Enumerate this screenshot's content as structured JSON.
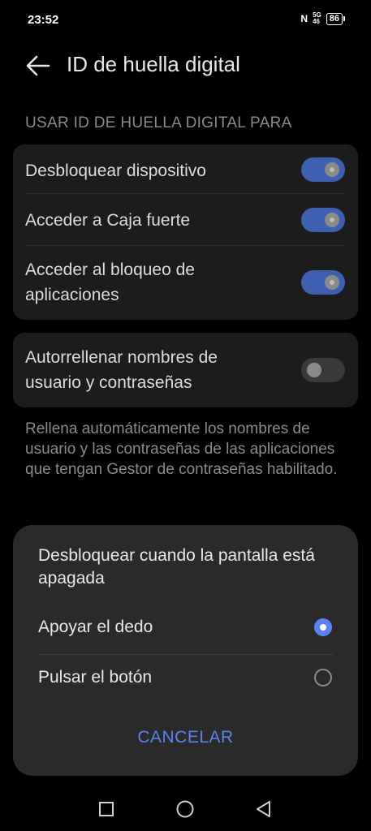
{
  "status_bar": {
    "time": "23:52",
    "nfc": "N",
    "signal_top": "5G",
    "signal_bottom": "46",
    "battery": "86"
  },
  "header": {
    "title": "ID de huella digital",
    "back_icon": "arrow-left-icon"
  },
  "section": {
    "label": "USAR ID DE HUELLA DIGITAL PARA"
  },
  "settings": [
    {
      "label": "Desbloquear dispositivo",
      "enabled": true
    },
    {
      "label": "Acceder a Caja fuerte",
      "enabled": true
    },
    {
      "label": "Acceder al bloqueo de aplicaciones",
      "enabled": true
    }
  ],
  "autofill": {
    "label": "Autorrellenar nombres de usuario y contraseñas",
    "enabled": false
  },
  "help_text": "Rellena automáticamente los nombres de usuario y las contraseñas de las aplicaciones que tengan Gestor de contraseñas habilitado.",
  "dialog": {
    "title": "Desbloquear cuando la pantalla está apagada",
    "options": [
      {
        "label": "Apoyar el dedo",
        "selected": true
      },
      {
        "label": "Pulsar el botón",
        "selected": false
      }
    ],
    "cancel_label": "CANCELAR"
  },
  "nav_bar": {
    "icons": [
      "recents-square-icon",
      "home-circle-icon",
      "back-triangle-icon"
    ]
  },
  "colors": {
    "accent": "#5b82f0",
    "toggle_on": "#3f5fb0",
    "card": "#1c1c1c",
    "dialog": "#2a2a2a"
  }
}
